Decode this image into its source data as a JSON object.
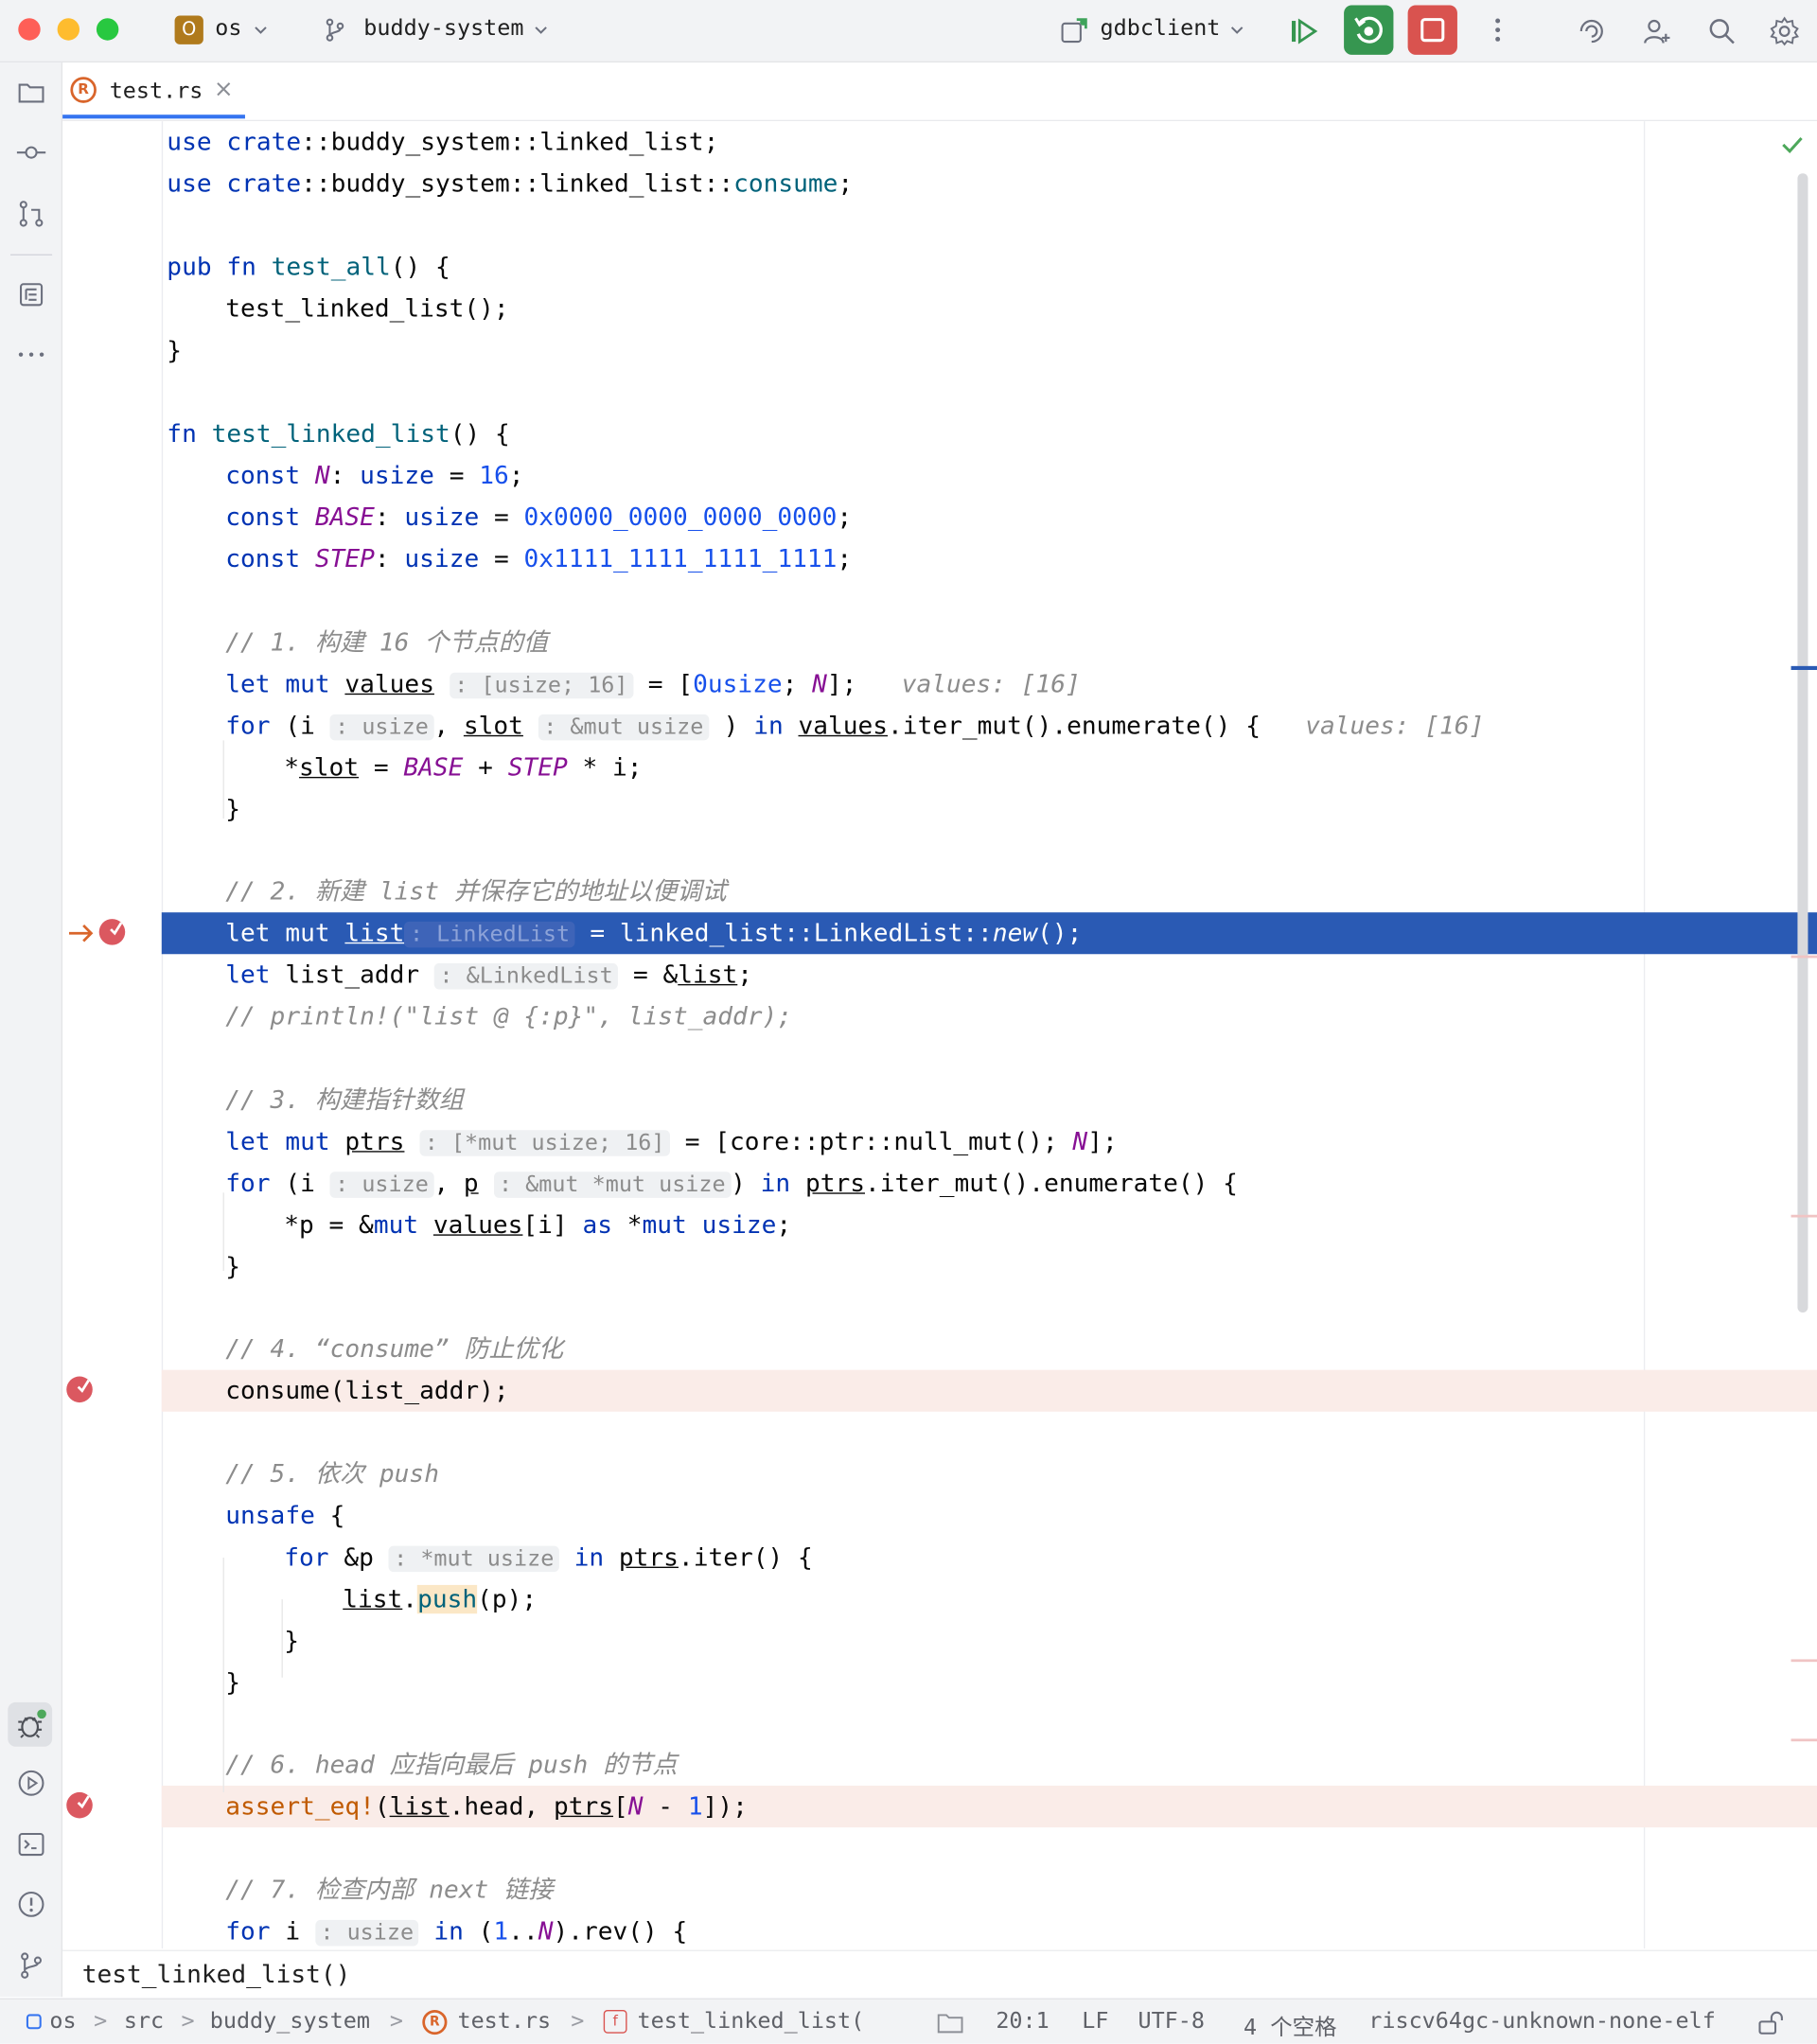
{
  "titlebar": {
    "project_badge": "O",
    "project": "os",
    "branch": "buddy-system",
    "run_config": "gdbclient"
  },
  "tab": {
    "filename": "test.rs",
    "close": "×"
  },
  "code": {
    "l1_a": "use",
    "l1_b": "crate",
    "l1_c": "::buddy_system::linked_list;",
    "l2_a": "use",
    "l2_b": "crate",
    "l2_c": "::buddy_system::linked_list::",
    "l2_d": "consume",
    "l2_e": ";",
    "l4_a": "pub",
    "l4_b": "fn",
    "l4_c": "test_all",
    "l4_d": "() {",
    "l5": "test_linked_list();",
    "l6": "}",
    "l8_a": "fn",
    "l8_b": "test_linked_list",
    "l8_c": "() {",
    "l9_a": "const",
    "l9_b": "N",
    "l9_c": ": ",
    "l9_d": "usize",
    "l9_e": " = ",
    "l9_f": "16",
    "l9_g": ";",
    "l10_a": "const",
    "l10_b": "BASE",
    "l10_c": ": ",
    "l10_d": "usize",
    "l10_e": " = ",
    "l10_f": "0x0000_0000_0000_0000",
    "l10_g": ";",
    "l11_a": "const",
    "l11_b": "STEP",
    "l11_c": ": ",
    "l11_d": "usize",
    "l11_e": " = ",
    "l11_f": "0x1111_1111_1111_1111",
    "l11_g": ";",
    "l13": "// 1. 构建 16 个节点的值",
    "l14_a": "let",
    "l14_b": "mut",
    "l14_c": "values",
    "l14_hint": ": [usize; 16]",
    "l14_d": " = [",
    "l14_e": "0usize",
    "l14_f": "; ",
    "l14_g": "N",
    "l14_h": "];",
    "l14_inl": "values: [16]",
    "l15_a": "for",
    "l15_b": " (i",
    "l15_hint1": ": usize",
    "l15_c": ", ",
    "l15_d": "slot",
    "l15_hint2": ": &mut usize",
    "l15_e": ") ",
    "l15_f": "in",
    "l15_g": "values",
    "l15_h": ".iter_mut().enumerate() {",
    "l15_inl": "values: [16]",
    "l16_a": "*",
    "l16_b": "slot",
    "l16_c": " = ",
    "l16_d": "BASE",
    "l16_e": " + ",
    "l16_f": "STEP",
    "l16_g": " * i;",
    "l17": "}",
    "l19": "// 2. 新建 list 并保存它的地址以便调试",
    "l20_a": "let",
    "l20_b": "mut",
    "l20_c": "list",
    "l20_hint": ": LinkedList",
    "l20_d": " = linked_list::LinkedList::",
    "l20_e": "new",
    "l20_f": "();",
    "l21_a": "let",
    "l21_b": " list_addr",
    "l21_hint": ": &LinkedList",
    "l21_c": " = &",
    "l21_d": "list",
    "l21_e": ";",
    "l22": "// println!(\"list @ {:p}\", list_addr);",
    "l24": "// 3. 构建指针数组",
    "l25_a": "let",
    "l25_b": "mut",
    "l25_c": "ptrs",
    "l25_hint": ": [*mut usize; 16]",
    "l25_d": " = [core::ptr::null_mut(); ",
    "l25_e": "N",
    "l25_f": "];",
    "l26_a": "for",
    "l26_b": " (i",
    "l26_hint1": ": usize",
    "l26_c": ", ",
    "l26_d": "p",
    "l26_hint2": ": &mut *mut usize",
    "l26_e": ") ",
    "l26_f": "in",
    "l26_g": "ptrs",
    "l26_h": ".iter_mut().enumerate() {",
    "l27_a": "*p = &",
    "l27_b": "mut",
    "l27_c": "values",
    "l27_d": "[i] ",
    "l27_e": "as",
    "l27_f": " *",
    "l27_g": "mut",
    "l27_h": "usize",
    "l27_i": ";",
    "l28": "}",
    "l30": "// 4. “consume” 防止优化",
    "l31": "consume(list_addr);",
    "l33": "// 5. 依次 push",
    "l34_a": "unsafe",
    "l34_b": " {",
    "l35_a": "for",
    "l35_b": " &p",
    "l35_hint": ": *mut usize",
    "l35_c": "in",
    "l35_d": "ptrs",
    "l35_e": ".iter() {",
    "l36_a": "list",
    "l36_b": ".",
    "l36_c": "push",
    "l36_d": "(p);",
    "l37": "}",
    "l38": "}",
    "l40": "// 6. head 应指向最后 push 的节点",
    "l41_a": "assert_eq!",
    "l41_b": "(",
    "l41_c": "list",
    "l41_d": ".head, ",
    "l41_e": "ptrs",
    "l41_f": "[",
    "l41_g": "N",
    "l41_h": " - ",
    "l41_i": "1",
    "l41_j": "]);",
    "l43": "// 7. 检查内部 next 链接",
    "l44_a": "for",
    "l44_b": " i",
    "l44_hint": ": usize",
    "l44_c": "in",
    "l44_d": " (",
    "l44_e": "1",
    "l44_f": "..",
    "l44_g": "N",
    "l44_h": ").rev() {"
  },
  "breadcrumb_fn": "test_linked_list()",
  "status": {
    "crumb_project": "os",
    "crumb_src": "src",
    "crumb_module": "buddy_system",
    "crumb_file": "test.rs",
    "crumb_fn": "test_linked_list(",
    "position": "20:1",
    "line_sep": "LF",
    "encoding": "UTF-8",
    "indent": "4 个空格",
    "target": "riscv64gc-unknown-none-elf"
  },
  "colors": {
    "exec_line_bg": "#2a5ab4",
    "breakpoint_line_bg": "#faece8",
    "breakpoint": "#db5860",
    "keyword": "#0033b3",
    "constant": "#871094",
    "number": "#1750eb",
    "run_green": "#369650",
    "stop_red": "#d9534f"
  }
}
